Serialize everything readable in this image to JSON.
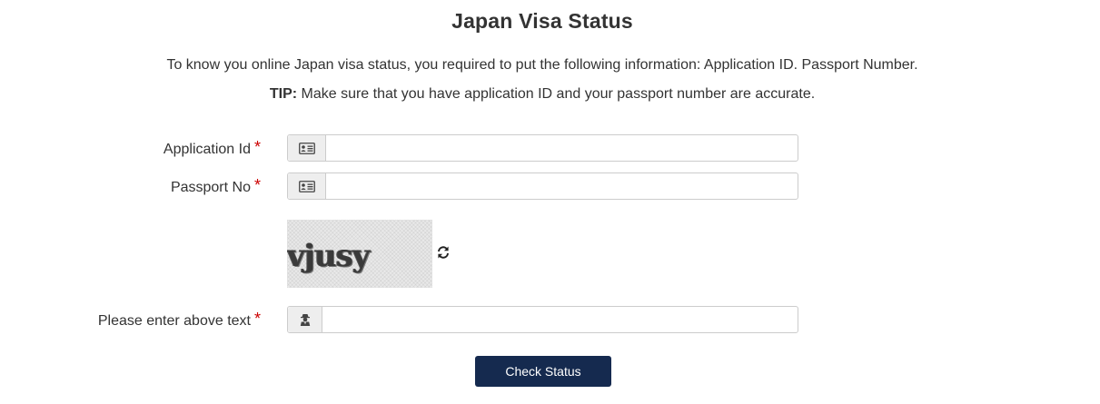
{
  "header": {
    "title": "Japan Visa Status",
    "intro": "To know you online Japan visa status, you required to put the following information: Application ID. Passport Number.",
    "tip_label": "TIP:",
    "tip_text": " Make sure that you have application ID and your passport number are accurate."
  },
  "form": {
    "application_id": {
      "label": "Application Id",
      "required_mark": "*",
      "value": "",
      "icon": "id-card-icon"
    },
    "passport_no": {
      "label": "Passport No",
      "required_mark": "*",
      "value": "",
      "icon": "id-card-icon"
    },
    "captcha": {
      "image_text": "vjusy",
      "refresh_icon": "refresh-icon"
    },
    "captcha_input": {
      "label": "Please enter above text",
      "required_mark": "*",
      "value": "",
      "icon": "user-secret-icon"
    },
    "submit_label": "Check Status"
  },
  "colors": {
    "button_bg": "#152a4f",
    "required": "#cc0000",
    "text": "#333333"
  }
}
